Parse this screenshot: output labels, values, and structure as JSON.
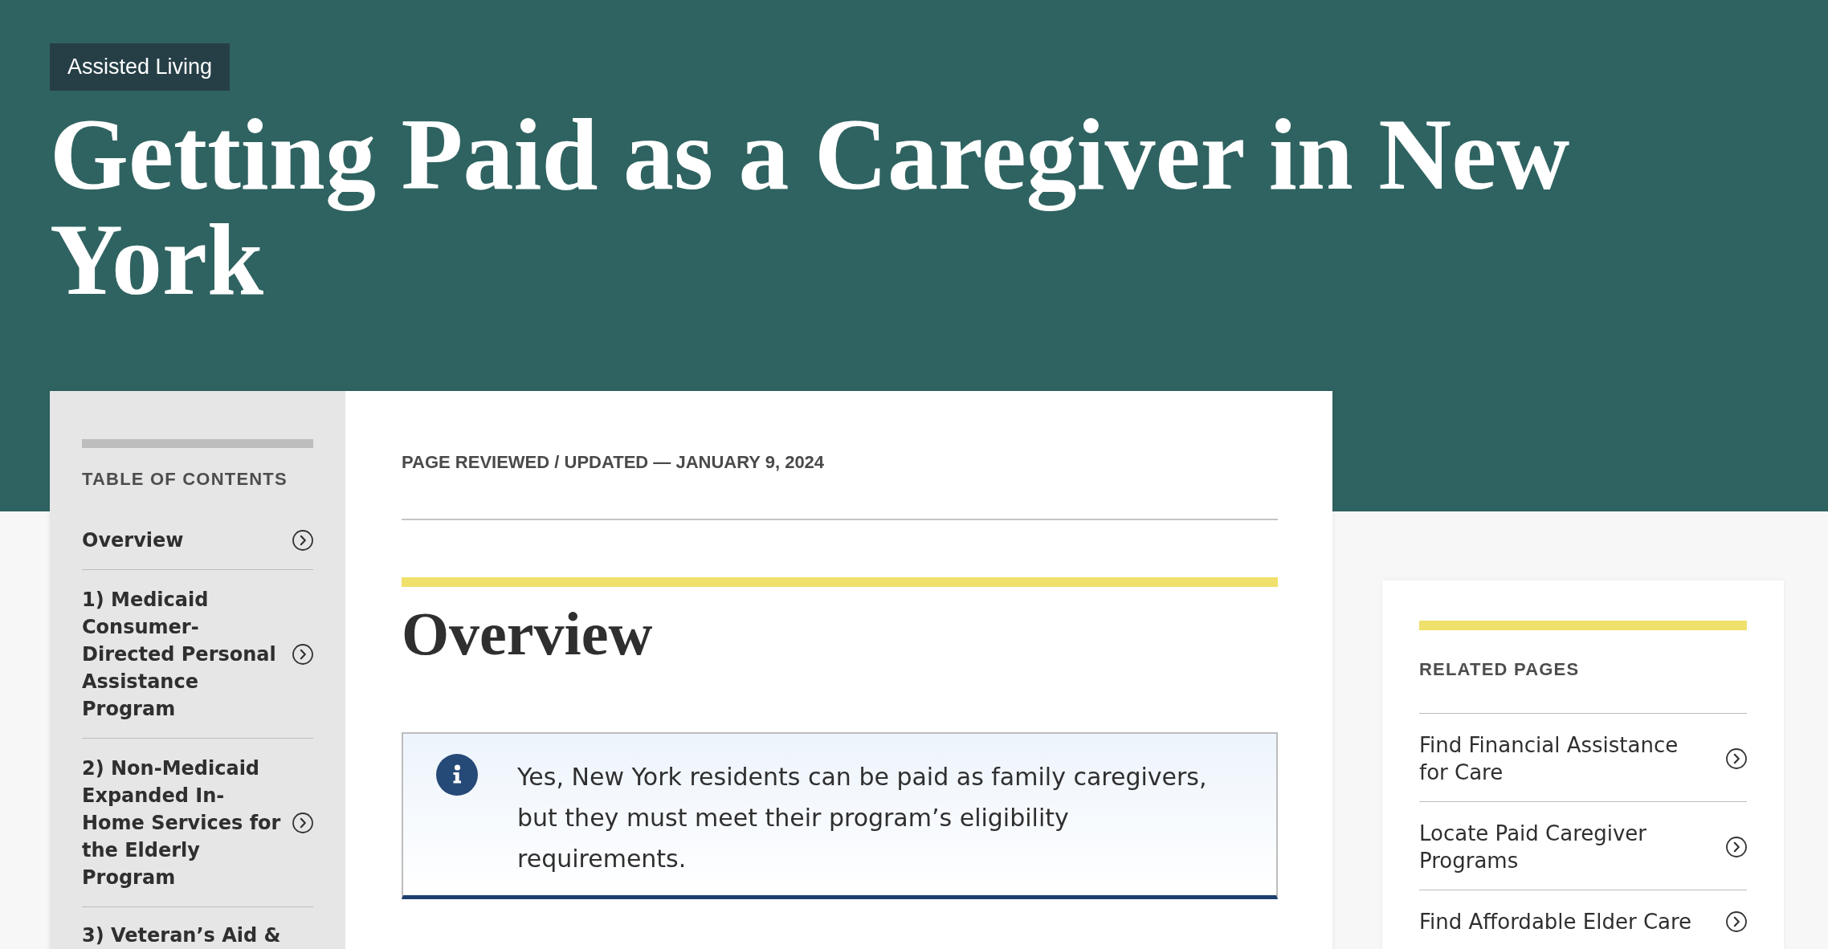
{
  "header": {
    "category_tag": "Assisted Living",
    "title": "Getting Paid as a Caregiver in New York"
  },
  "table_of_contents": {
    "heading": "TABLE OF CONTENTS",
    "items": [
      {
        "label": "Overview",
        "cut_off": false
      },
      {
        "label": "1) Medicaid Consumer-Directed Personal Assistance Program",
        "cut_off": false
      },
      {
        "label": "2) Non-Medicaid Expanded In-Home Services for the Elderly Program",
        "cut_off": false
      },
      {
        "label": "3) Veteran’s Aid &",
        "cut_off": true
      }
    ]
  },
  "article": {
    "reviewed_line": "PAGE REVIEWED / UPDATED — JANUARY 9, 2024",
    "section_heading": "Overview",
    "info_callout": "Yes, New York residents can be paid as family caregivers, but they must meet their program’s eligibility requirements."
  },
  "related_pages": {
    "heading": "RELATED PAGES",
    "links": [
      "Find Financial Assistance for Care",
      "Locate Paid Caregiver Programs",
      "Find Affordable Elder Care"
    ]
  }
}
